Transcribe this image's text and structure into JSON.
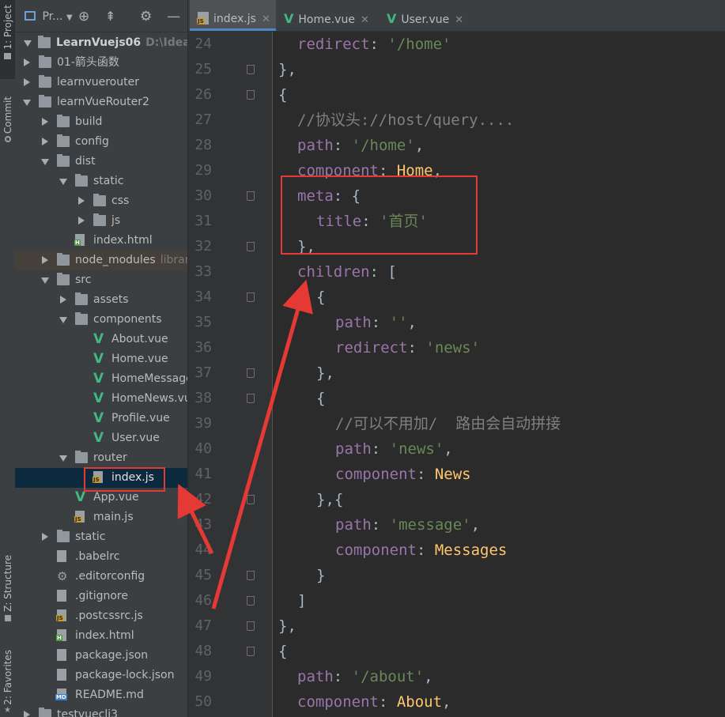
{
  "sidebar_tabs": {
    "project": "1: Project",
    "commit": "Commit",
    "structure": "Z: Structure",
    "favorites": "2: Favorites"
  },
  "project_panel": {
    "title": "Pr...",
    "root_name": "LearnVuejs06",
    "root_path": "D:\\IdeaProje",
    "tree": [
      {
        "depth": 0,
        "type": "folder",
        "state": "collapsed",
        "label": "01-箭头函数"
      },
      {
        "depth": 0,
        "type": "folder",
        "state": "collapsed",
        "label": "learnvuerouter"
      },
      {
        "depth": 0,
        "type": "folder",
        "state": "expanded",
        "label": "learnVueRouter2"
      },
      {
        "depth": 1,
        "type": "folder",
        "state": "collapsed",
        "label": "build"
      },
      {
        "depth": 1,
        "type": "folder",
        "state": "collapsed",
        "label": "config"
      },
      {
        "depth": 1,
        "type": "folder",
        "state": "expanded",
        "label": "dist"
      },
      {
        "depth": 2,
        "type": "folder",
        "state": "expanded",
        "label": "static"
      },
      {
        "depth": 3,
        "type": "folder",
        "state": "collapsed",
        "label": "css"
      },
      {
        "depth": 3,
        "type": "folder",
        "state": "collapsed",
        "label": "js"
      },
      {
        "depth": 2,
        "type": "html",
        "label": "index.html"
      },
      {
        "depth": 1,
        "type": "folder",
        "state": "collapsed",
        "label": "node_modules",
        "hint": "librar",
        "style": "dim"
      },
      {
        "depth": 1,
        "type": "folder",
        "state": "expanded",
        "label": "src"
      },
      {
        "depth": 2,
        "type": "folder",
        "state": "collapsed",
        "label": "assets"
      },
      {
        "depth": 2,
        "type": "folder",
        "state": "expanded",
        "label": "components"
      },
      {
        "depth": 3,
        "type": "vue",
        "label": "About.vue"
      },
      {
        "depth": 3,
        "type": "vue",
        "label": "Home.vue"
      },
      {
        "depth": 3,
        "type": "vue",
        "label": "HomeMessage"
      },
      {
        "depth": 3,
        "type": "vue",
        "label": "HomeNews.vu"
      },
      {
        "depth": 3,
        "type": "vue",
        "label": "Profile.vue"
      },
      {
        "depth": 3,
        "type": "vue",
        "label": "User.vue"
      },
      {
        "depth": 2,
        "type": "folder",
        "state": "expanded",
        "label": "router"
      },
      {
        "depth": 3,
        "type": "js",
        "label": "index.js",
        "style": "selected"
      },
      {
        "depth": 2,
        "type": "vue",
        "label": "App.vue"
      },
      {
        "depth": 2,
        "type": "js",
        "label": "main.js"
      },
      {
        "depth": 1,
        "type": "folder",
        "state": "collapsed",
        "label": "static"
      },
      {
        "depth": 1,
        "type": "config",
        "label": ".babelrc"
      },
      {
        "depth": 1,
        "type": "gear",
        "label": ".editorconfig"
      },
      {
        "depth": 1,
        "type": "config",
        "label": ".gitignore"
      },
      {
        "depth": 1,
        "type": "js",
        "label": ".postcssrc.js"
      },
      {
        "depth": 1,
        "type": "html",
        "label": "index.html"
      },
      {
        "depth": 1,
        "type": "config",
        "label": "package.json"
      },
      {
        "depth": 1,
        "type": "config",
        "label": "package-lock.json"
      },
      {
        "depth": 1,
        "type": "md",
        "label": "README.md"
      },
      {
        "depth": 0,
        "type": "folder",
        "state": "collapsed",
        "label": "testvuecli3"
      }
    ]
  },
  "editor_tabs": [
    {
      "label": "index.js",
      "icon": "js",
      "active": true
    },
    {
      "label": "Home.vue",
      "icon": "vue",
      "active": false
    },
    {
      "label": "User.vue",
      "icon": "vue",
      "active": false
    }
  ],
  "code_lines": [
    {
      "n": "24",
      "fold": false,
      "indent": 1,
      "tokens": [
        [
          "key",
          "redirect"
        ],
        [
          "p",
          ": "
        ],
        [
          "str",
          "'/home'"
        ]
      ]
    },
    {
      "n": "25",
      "fold": true,
      "indent": 0,
      "tokens": [
        [
          "p",
          "},"
        ]
      ]
    },
    {
      "n": "26",
      "fold": true,
      "indent": 0,
      "tokens": [
        [
          "p",
          "{"
        ]
      ]
    },
    {
      "n": "27",
      "fold": false,
      "indent": 1,
      "tokens": [
        [
          "cmt",
          "//协议头://host/query...."
        ]
      ]
    },
    {
      "n": "28",
      "fold": false,
      "indent": 1,
      "tokens": [
        [
          "key",
          "path"
        ],
        [
          "p",
          ": "
        ],
        [
          "str",
          "'/home'"
        ],
        [
          "p",
          ","
        ]
      ]
    },
    {
      "n": "29",
      "fold": false,
      "indent": 1,
      "tokens": [
        [
          "key",
          "component"
        ],
        [
          "p",
          ": "
        ],
        [
          "val",
          "Home"
        ],
        [
          "p",
          ","
        ]
      ]
    },
    {
      "n": "30",
      "fold": true,
      "indent": 1,
      "tokens": [
        [
          "key",
          "meta"
        ],
        [
          "p",
          ": {"
        ]
      ]
    },
    {
      "n": "31",
      "fold": false,
      "indent": 2,
      "tokens": [
        [
          "key",
          "title"
        ],
        [
          "p",
          ": "
        ],
        [
          "str",
          "'首页'"
        ]
      ]
    },
    {
      "n": "32",
      "fold": true,
      "indent": 1,
      "tokens": [
        [
          "p",
          "},"
        ]
      ]
    },
    {
      "n": "33",
      "fold": false,
      "indent": 1,
      "tokens": [
        [
          "key",
          "children"
        ],
        [
          "p",
          ": ["
        ]
      ]
    },
    {
      "n": "34",
      "fold": true,
      "indent": 2,
      "tokens": [
        [
          "p",
          "{"
        ]
      ]
    },
    {
      "n": "35",
      "fold": false,
      "indent": 3,
      "tokens": [
        [
          "key",
          "path"
        ],
        [
          "p",
          ": "
        ],
        [
          "str",
          "''"
        ],
        [
          "p",
          ","
        ]
      ]
    },
    {
      "n": "36",
      "fold": false,
      "indent": 3,
      "tokens": [
        [
          "key",
          "redirect"
        ],
        [
          "p",
          ": "
        ],
        [
          "str",
          "'news'"
        ]
      ]
    },
    {
      "n": "37",
      "fold": true,
      "indent": 2,
      "tokens": [
        [
          "p",
          "},"
        ]
      ]
    },
    {
      "n": "38",
      "fold": true,
      "indent": 2,
      "tokens": [
        [
          "p",
          "{"
        ]
      ]
    },
    {
      "n": "39",
      "fold": false,
      "indent": 3,
      "tokens": [
        [
          "cmt",
          "//可以不用加/  路由会自动拼接"
        ]
      ]
    },
    {
      "n": "40",
      "fold": false,
      "indent": 3,
      "tokens": [
        [
          "key",
          "path"
        ],
        [
          "p",
          ": "
        ],
        [
          "str",
          "'news'"
        ],
        [
          "p",
          ","
        ]
      ]
    },
    {
      "n": "41",
      "fold": false,
      "indent": 3,
      "tokens": [
        [
          "key",
          "component"
        ],
        [
          "p",
          ": "
        ],
        [
          "val",
          "News"
        ]
      ]
    },
    {
      "n": "42",
      "fold": true,
      "indent": 2,
      "tokens": [
        [
          "p",
          "},{"
        ]
      ]
    },
    {
      "n": "43",
      "fold": false,
      "indent": 3,
      "tokens": [
        [
          "key",
          "path"
        ],
        [
          "p",
          ": "
        ],
        [
          "str",
          "'message'"
        ],
        [
          "p",
          ","
        ]
      ]
    },
    {
      "n": "44",
      "fold": false,
      "indent": 3,
      "tokens": [
        [
          "key",
          "component"
        ],
        [
          "p",
          ": "
        ],
        [
          "val",
          "Messages"
        ]
      ]
    },
    {
      "n": "45",
      "fold": true,
      "indent": 2,
      "tokens": [
        [
          "p",
          "}"
        ]
      ]
    },
    {
      "n": "46",
      "fold": true,
      "indent": 1,
      "tokens": [
        [
          "p",
          "]"
        ]
      ]
    },
    {
      "n": "47",
      "fold": true,
      "indent": 0,
      "tokens": [
        [
          "p",
          "},"
        ]
      ]
    },
    {
      "n": "48",
      "fold": true,
      "indent": 0,
      "tokens": [
        [
          "p",
          "{"
        ]
      ]
    },
    {
      "n": "49",
      "fold": false,
      "indent": 1,
      "tokens": [
        [
          "key",
          "path"
        ],
        [
          "p",
          ": "
        ],
        [
          "str",
          "'/about'"
        ],
        [
          "p",
          ","
        ]
      ]
    },
    {
      "n": "50",
      "fold": false,
      "indent": 1,
      "tokens": [
        [
          "key",
          "component"
        ],
        [
          "p",
          ": "
        ],
        [
          "val",
          "About"
        ],
        [
          "p",
          ","
        ]
      ]
    }
  ],
  "colors": {
    "keyword_purple": "#9876aa",
    "string_green": "#6a8759",
    "value_yellow": "#ffc66d",
    "comment_gray": "#808080",
    "annotation_red": "#e53935",
    "vue_green": "#41b883"
  }
}
